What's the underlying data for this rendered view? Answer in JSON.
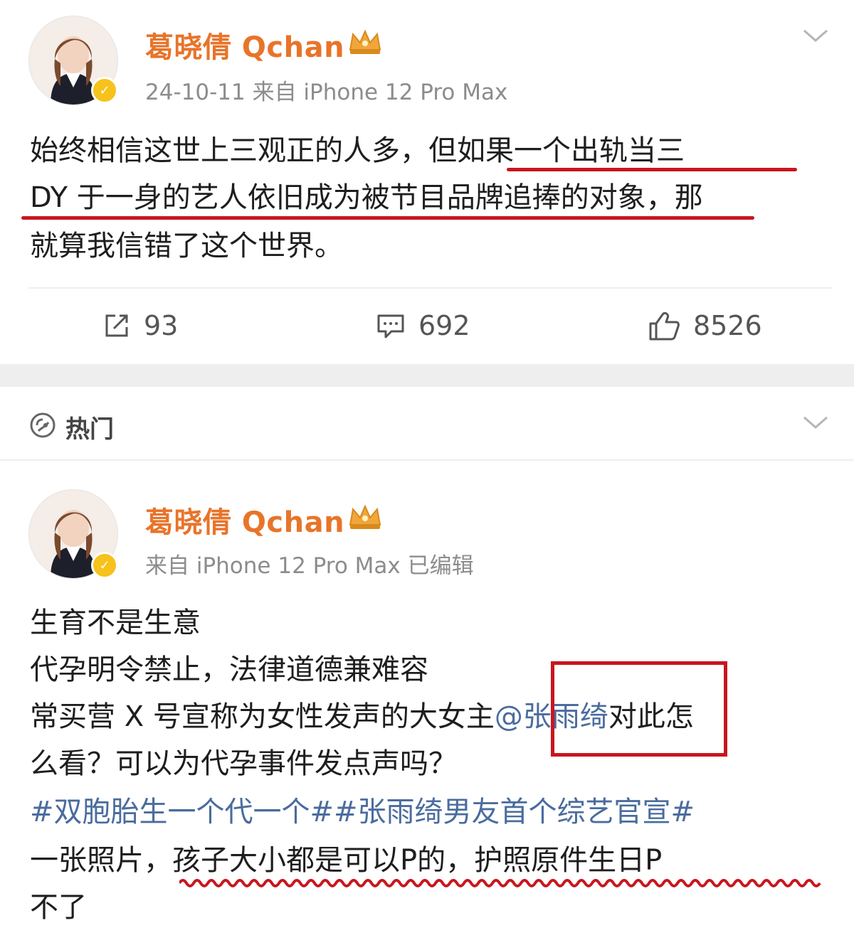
{
  "post1": {
    "author": "葛晓倩 Qchan",
    "meta": "24-10-11  来自 iPhone 12 Pro Max",
    "lines": [
      "始终相信这世上三观正的人多，但如果一个出轨当三",
      "DY 于一身的艺人依旧成为被节目品牌追捧的对象，那",
      "就算我信错了这个世界。"
    ],
    "actions": {
      "repost_count": "93",
      "comment_count": "692",
      "like_count": "8526"
    }
  },
  "section": {
    "hot_label": "热门"
  },
  "post2": {
    "author": "葛晓倩 Qchan",
    "meta": "来自 iPhone 12 Pro Max  已编辑",
    "line1": "生育不是生意",
    "line2": "代孕明令禁止，法律道德兼难容",
    "line3_before": "常买营 X 号宣称为女性发声的大女主",
    "mention": "@张雨绮",
    "line3_after": "对此怎",
    "line4": "么看？可以为代孕事件发点声吗？",
    "hashtags": "#双胞胎生一个代一个##张雨绮男友首个综艺官宣#",
    "line6": "一张照片，孩子大小都是可以P的，护照原件生日P",
    "line7": "不了"
  },
  "colors": {
    "author_orange": "#e8742a",
    "link_blue": "#4a6c9e",
    "underline_red": "#c8161e",
    "verified_yellow": "#f6c21b"
  }
}
